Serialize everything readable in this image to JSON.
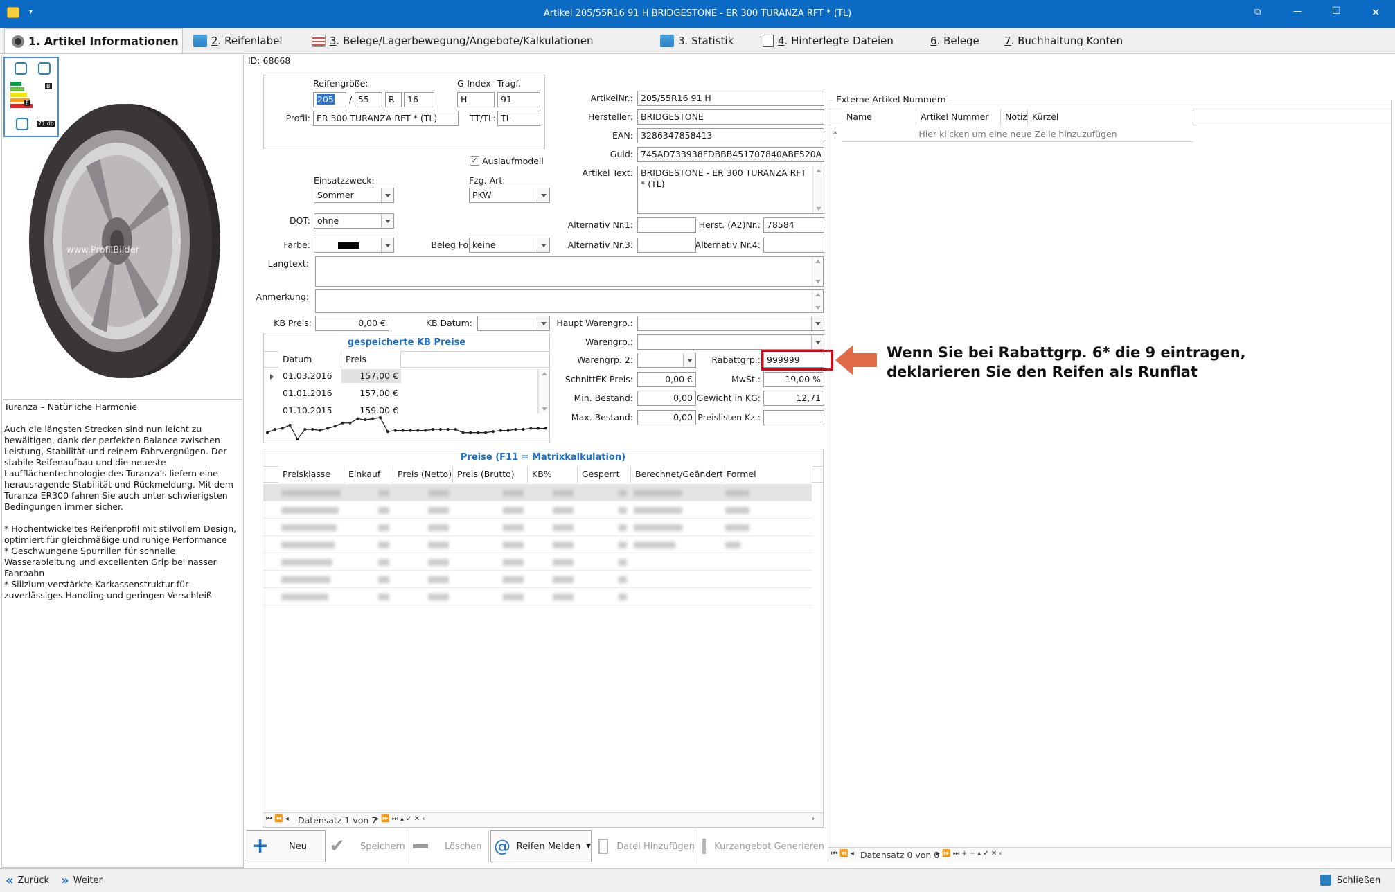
{
  "window": {
    "title": "Artikel 205/55R16 91 H BRIDGESTONE - ER 300 TURANZA RFT * (TL)",
    "minimize": "—",
    "maximize": "☐",
    "close": "✕"
  },
  "tabs": [
    {
      "num": "1",
      "label": ". Artikel Informationen"
    },
    {
      "num": "2",
      "label": ". Reifenlabel"
    },
    {
      "num": "3",
      "label": ". Belege/Lagerbewegung/Angebote/Kalkulationen"
    },
    {
      "num": "",
      "label": "3. Statistik"
    },
    {
      "num": "4",
      "label": ". Hinterlegte Dateien"
    },
    {
      "num": "6",
      "label": ". Belege"
    },
    {
      "num": "7",
      "label": ". Buchhaltung Konten"
    }
  ],
  "image": {
    "watermark": "www.ProfilBilder"
  },
  "label_badges": {
    "class": "B",
    "wet": "F",
    "noise": "71 db"
  },
  "description": {
    "title": "Turanza – Natürliche Harmonie",
    "para1": "Auch die längsten Strecken sind nun leicht zu bewältigen, dank der perfekten Balance zwischen Leistung, Stabilität und reinem Fahrvergnügen. Der stabile Reifenaufbau und die neueste Laufflächentechnologie des Turanza's liefern eine herausragende Stabilität und Rückmeldung. Mit dem Turanza ER300 fahren Sie auch unter schwierigsten Bedingungen immer sicher.",
    "bullet1": "* Hochentwickeltes Reifenprofil mit stilvollem Design, optimiert für gleichmäßige und ruhige Performance",
    "bullet2": "* Geschwungene Spurrillen für schnelle Wasserableitung und excellenten Grip bei nasser Fahrbahn",
    "bullet3": "* Silizium-verstärkte Karkassenstruktur für zuverlässiges Handling und geringen Verschleiß"
  },
  "id_label": "ID: 68668",
  "size": {
    "label": "Reifengröße:",
    "width": "205",
    "sep": "/",
    "ratio": "55",
    "type": "R",
    "rim": "16",
    "gindex_label": "G-Index",
    "gindex": "H",
    "tragf_label": "Tragf.",
    "tragf": "91",
    "profil_label": "Profil:",
    "profil": "ER 300 TURANZA RFT * (TL)",
    "tttl_label": "TT/TL:",
    "tttl": "TL"
  },
  "auslauf": {
    "label": "Auslaufmodell",
    "check": "✓"
  },
  "einsatz": {
    "label": "Einsatzzweck:",
    "value": "Sommer"
  },
  "fzg": {
    "label": "Fzg. Art:",
    "value": "PKW"
  },
  "dot": {
    "label": "DOT:",
    "value": "ohne"
  },
  "farbe": {
    "label": "Farbe:"
  },
  "belegformat": {
    "label": "Beleg Format:",
    "value": "keine"
  },
  "langtext": {
    "label": "Langtext:"
  },
  "anmerkung": {
    "label": "Anmerkung:"
  },
  "kbpreis": {
    "label": "KB Preis:",
    "value": "0,00 €"
  },
  "kbdatum": {
    "label": "KB Datum:"
  },
  "kbtable": {
    "title": "gespeicherte KB Preise",
    "col_datum": "Datum",
    "col_preis": "Preis",
    "rows": [
      {
        "datum": "01.03.2016",
        "preis": "157,00 €"
      },
      {
        "datum": "01.01.2016",
        "preis": "157,00 €"
      },
      {
        "datum": "01.10.2015",
        "preis": "159,00 €"
      }
    ],
    "sparkline": [
      150,
      153,
      154,
      157,
      144,
      153,
      153,
      152,
      154,
      156,
      159,
      159,
      163,
      162,
      163,
      164,
      151,
      152,
      152,
      152,
      152,
      152,
      153,
      153,
      153,
      153,
      150,
      150,
      150,
      150,
      151,
      152,
      152,
      153,
      153,
      154,
      154,
      154
    ]
  },
  "artikel": {
    "artikelnr_label": "ArtikelNr.:",
    "artikelnr": "205/55R16 91 H",
    "hersteller_label": "Hersteller:",
    "hersteller": "BRIDGESTONE",
    "ean_label": "EAN:",
    "ean": "3286347858413",
    "guid_label": "Guid:",
    "guid": "745AD733938FDBBB451707840ABE520A",
    "text_label": "Artikel Text:",
    "text": "BRIDGESTONE - ER 300 TURANZA RFT * (TL)",
    "alt1_label": "Alternativ Nr.1:",
    "a2_label": "Herst. (A2)Nr.:",
    "a2": "78584",
    "alt3_label": "Alternativ Nr.3:",
    "alt4_label": "Alternativ Nr.4:",
    "hauptwg_label": "Haupt Warengrp.:",
    "wg_label": "Warengrp.:",
    "wg2_label": "Warengrp. 2:",
    "rabatt_label": "Rabattgrp.:",
    "rabatt": "999999",
    "schnitt_label": "SchnittEK Preis:",
    "schnitt": "0,00 €",
    "mwst_label": "MwSt.:",
    "mwst": "19,00 %",
    "minbestand_label": "Min. Bestand:",
    "minbestand": "0,00",
    "gewicht_label": "Gewicht in KG:",
    "gewicht": "12,71",
    "maxbestand_label": "Max. Bestand:",
    "maxbestand": "0,00",
    "preisliste_label": "Preislisten Kz.:"
  },
  "callout": {
    "line1": "Wenn Sie bei Rabattgrp. 6* die 9 eintragen,",
    "line2": "deklarieren Sie den Reifen als Runflat"
  },
  "extern": {
    "title": "Externe Artikel Nummern",
    "col_name": "Name",
    "col_nummer": "Artikel Nummer",
    "col_notiz": "Notiz",
    "col_kuerzel": "Kürzel",
    "star": "*",
    "newrow": "Hier klicken um eine neue Zeile hinzuzufügen",
    "nav": "Datensatz 0 von 0"
  },
  "preise": {
    "title": "Preise (F11 = Matrixkalkulation)",
    "cols": [
      "Preisklasse",
      "Einkauf",
      "Preis (Netto)",
      "Preis (Brutto)",
      "KB%",
      "Gesperrt",
      "Berechnet/Geändert",
      "Formel"
    ],
    "nav": "Datensatz 1 von 7"
  },
  "toolbar": {
    "neu": "Neu",
    "speichern": "Speichern",
    "loeschen": "Löschen",
    "melden": "Reifen Melden",
    "datei": "Datei Hinzufügen",
    "kurz": "Kurzangebot Generieren"
  },
  "footer": {
    "zurueck": "Zurück",
    "weiter": "Weiter",
    "schliessen": "Schließen"
  }
}
